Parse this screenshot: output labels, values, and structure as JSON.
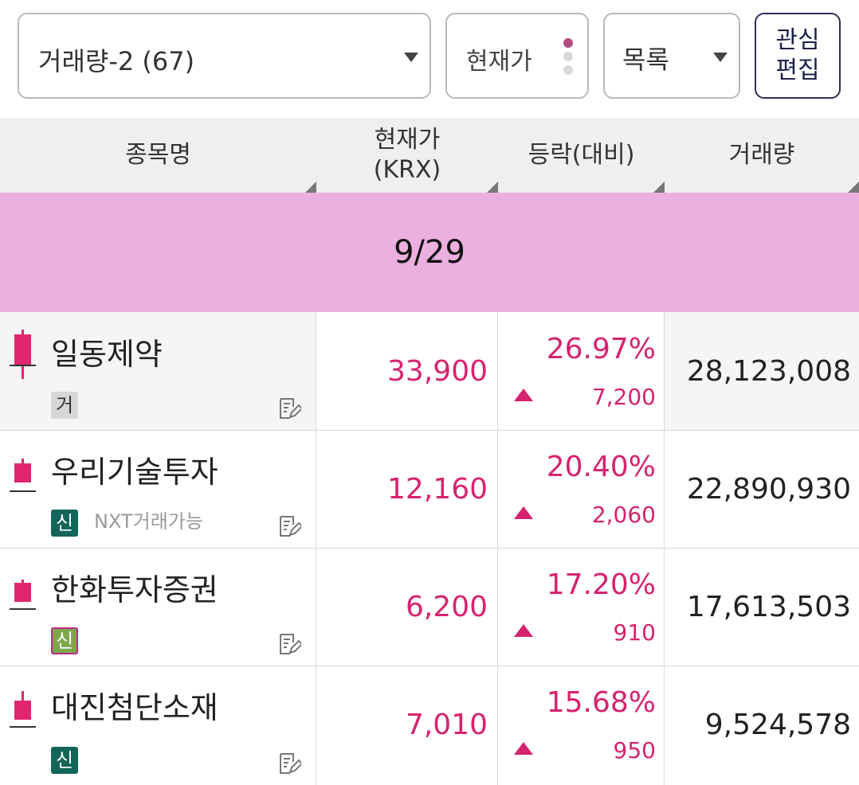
{
  "toolbar": {
    "group_label": "거래량-2 (67)",
    "price_toggle_label": "현재가",
    "view_label": "목록",
    "edit_label": "관심\n편집"
  },
  "table": {
    "headers": {
      "name": "종목명",
      "price": "현재가\n(KRX)",
      "change": "등락(대비)",
      "volume": "거래량"
    },
    "date_band": "9/29",
    "rows": [
      {
        "name": "일동제약",
        "badge": "거",
        "note": "",
        "price": "33,900",
        "pct": "26.97%",
        "diff": "7,200",
        "volume": "28,123,008"
      },
      {
        "name": "우리기술투자",
        "badge": "신",
        "note": "NXT거래가능",
        "price": "12,160",
        "pct": "20.40%",
        "diff": "2,060",
        "volume": "22,890,930"
      },
      {
        "name": "한화투자증권",
        "badge": "신",
        "note": "",
        "price": "6,200",
        "pct": "17.20%",
        "diff": "910",
        "volume": "17,613,503"
      },
      {
        "name": "대진첨단소재",
        "badge": "신",
        "note": "",
        "price": "7,010",
        "pct": "15.68%",
        "diff": "950",
        "volume": "9,524,578"
      }
    ]
  },
  "colors": {
    "up": "#d6236f",
    "band": "#ecb0e0",
    "header_bg": "#efefef"
  },
  "icons": [
    "caret-down-icon",
    "toggle-dots-icon",
    "sort-corner-icon",
    "candle-icon",
    "up-arrow-icon",
    "memo-edit-icon"
  ]
}
